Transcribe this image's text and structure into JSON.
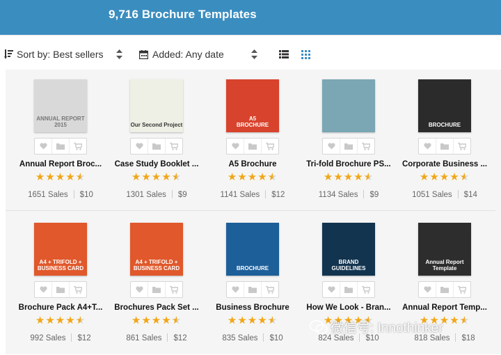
{
  "header": {
    "title": "9,716 Brochure Templates"
  },
  "toolbar": {
    "sort_label": "Sort by: Best sellers",
    "added_label": "Added: Any date",
    "view_options": [
      "list-icon",
      "grid-icon"
    ],
    "active_view": "grid-icon"
  },
  "colors": {
    "header": "#3a8dbf",
    "accent": "#3a8dbf",
    "star": "#f2a614"
  },
  "actions": [
    "heart-icon",
    "folder-icon",
    "cart-icon"
  ],
  "products": [
    {
      "name": "Annual Report Broc...",
      "stars": 4.5,
      "sales": "1651 Sales",
      "price": "$10",
      "thumb": {
        "bg": "#d9d9d9",
        "label": "ANNUAL REPORT\n2015",
        "fg": "#777"
      }
    },
    {
      "name": "Case Study Booklet ...",
      "stars": 4.5,
      "sales": "1301 Sales",
      "price": "$9",
      "thumb": {
        "bg": "#eef0e6",
        "label": "Our Second Project",
        "fg": "#333"
      }
    },
    {
      "name": "A5 Brochure",
      "stars": 4.5,
      "sales": "1141 Sales",
      "price": "$12",
      "thumb": {
        "bg": "#d8432d",
        "label": "A5\nBROCHURE",
        "fg": "#ffffff"
      }
    },
    {
      "name": "Tri-fold Brochure PS...",
      "stars": 4.5,
      "sales": "1134 Sales",
      "price": "$9",
      "thumb": {
        "bg": "#7aa7b3",
        "label": "",
        "fg": "#fff"
      }
    },
    {
      "name": "Corporate Business ...",
      "stars": 4.5,
      "sales": "1051 Sales",
      "price": "$14",
      "thumb": {
        "bg": "#2b2b2b",
        "label": "BROCHURE",
        "fg": "#ffffff"
      }
    },
    {
      "name": "Brochure Pack A4+T...",
      "stars": 4.5,
      "sales": "992 Sales",
      "price": "$12",
      "thumb": {
        "bg": "#e0582b",
        "label": "A4 + TRIFOLD +\nBUSINESS CARD",
        "fg": "#ffffff"
      }
    },
    {
      "name": "Brochures Pack Set ...",
      "stars": 4.5,
      "sales": "861 Sales",
      "price": "$12",
      "thumb": {
        "bg": "#e0582b",
        "label": "A4 + TRIFOLD +\nBUSINESS CARD",
        "fg": "#ffffff"
      }
    },
    {
      "name": "Business Brochure",
      "stars": 4.5,
      "sales": "835 Sales",
      "price": "$10",
      "thumb": {
        "bg": "#1d5f99",
        "label": "BROCHURE",
        "fg": "#ffffff"
      }
    },
    {
      "name": "How We Look - Bran...",
      "stars": 4.5,
      "sales": "824 Sales",
      "price": "$10",
      "thumb": {
        "bg": "#12344f",
        "label": "BRAND\nGUIDELINES",
        "fg": "#ffffff"
      }
    },
    {
      "name": "Annual Report Temp...",
      "stars": 4.5,
      "sales": "818 Sales",
      "price": "$18",
      "thumb": {
        "bg": "#2d2d2d",
        "label": "Annual Report\nTemplate",
        "fg": "#ffffff"
      }
    }
  ],
  "watermark": "微信号: Innothinker"
}
